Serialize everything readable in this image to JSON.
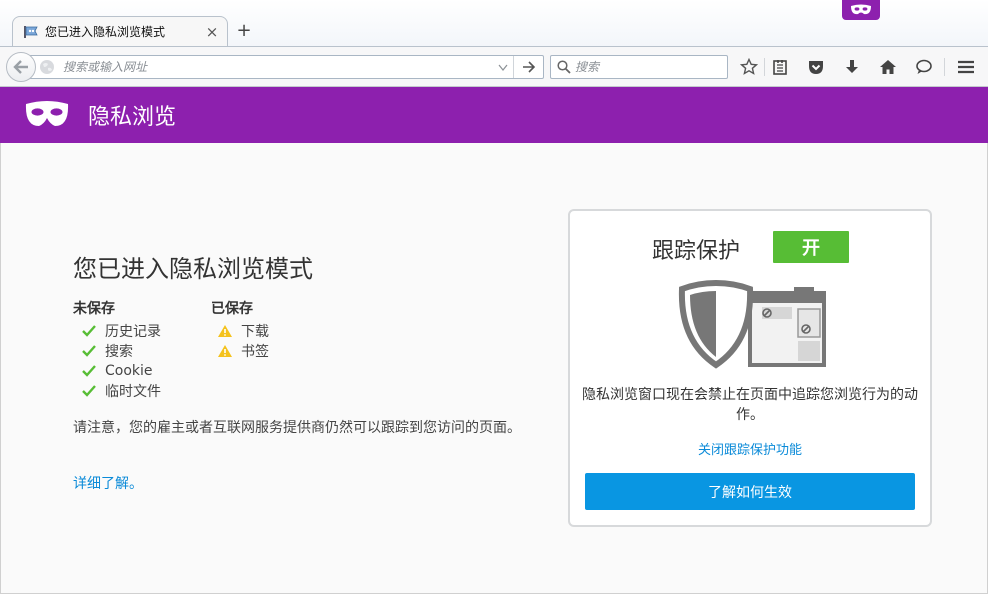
{
  "tab": {
    "title": "您已进入隐私浏览模式",
    "icon": "private-browsing-icon",
    "close_label": "×"
  },
  "newtab_label": "+",
  "urlbar": {
    "placeholder": "搜索或输入网址",
    "value": ""
  },
  "searchbar": {
    "placeholder": "搜索",
    "value": ""
  },
  "toolbar": {
    "icons": [
      "bookmark-star-icon",
      "reading-list-icon",
      "pocket-icon",
      "download-icon",
      "home-icon",
      "chat-icon",
      "hamburger-menu-icon"
    ]
  },
  "header": {
    "title": "隐私浏览",
    "icon": "private-mask-icon"
  },
  "main": {
    "title": "您已进入隐私浏览模式",
    "not_saved": {
      "heading": "未保存",
      "items": [
        "历史记录",
        "搜索",
        "Cookie",
        "临时文件"
      ]
    },
    "saved": {
      "heading": "已保存",
      "items": [
        "下载",
        "书签"
      ]
    },
    "note": "请注意，您的雇主或者互联网服务提供商仍然可以跟踪到您访问的页面。",
    "learn_more": "详细了解。"
  },
  "tracking": {
    "title": "跟踪保护",
    "state": "开",
    "description": "隐私浏览窗口现在会禁止在页面中追踪您浏览行为的动作。",
    "disable_link": "关闭跟踪保护功能",
    "button": "了解如何生效"
  },
  "colors": {
    "accent_purple": "#8d20ae",
    "check_green": "#57bd35",
    "warn_yellow": "#f4c21d",
    "link_blue": "#0a8ad8",
    "button_blue": "#0996e2"
  }
}
